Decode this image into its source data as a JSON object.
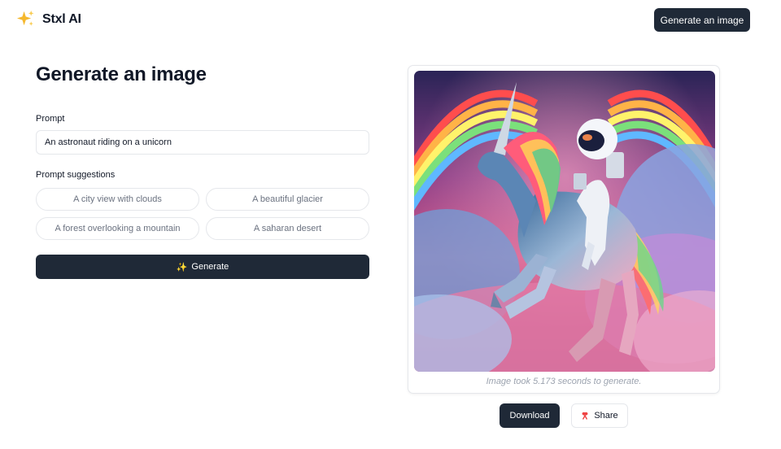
{
  "app": {
    "name": "Stxl AI",
    "logo_icon": "sparkles-icon"
  },
  "header": {
    "cta_label": "Generate an image"
  },
  "main": {
    "title": "Generate an image",
    "prompt": {
      "label": "Prompt",
      "value": "An astronaut riding on a unicorn"
    },
    "suggestions": {
      "label": "Prompt suggestions",
      "items": [
        "A city view with clouds",
        "A beautiful glacier",
        "A forest overlooking a mountain",
        "A saharan desert"
      ]
    },
    "generate_button": {
      "icon": "✨",
      "label": "Generate"
    }
  },
  "result": {
    "image_alt": "astronaut-riding-unicorn-image",
    "caption": "Image took 5.173 seconds to generate.",
    "download_label": "Download",
    "share_label": "Share",
    "share_icon": "ribbon-icon"
  },
  "colors": {
    "primary_dark": "#1f2937",
    "border": "#e5e7eb",
    "muted_text": "#9ca3af",
    "logo_gold": "#f5b82e"
  }
}
